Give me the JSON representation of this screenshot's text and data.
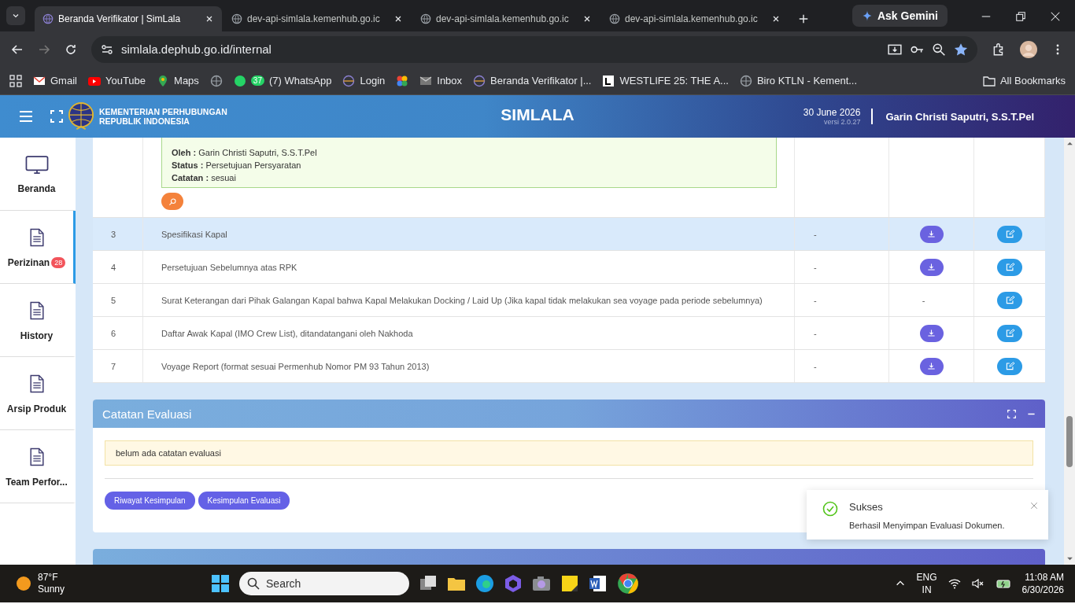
{
  "browser": {
    "tabs": [
      {
        "title": "Beranda Verifikator | SimLala",
        "selected": true
      },
      {
        "title": "dev-api-simlala.kemenhub.go.ic",
        "selected": false
      },
      {
        "title": "dev-api-simlala.kemenhub.go.ic",
        "selected": false
      },
      {
        "title": "dev-api-simlala.kemenhub.go.ic",
        "selected": false
      }
    ],
    "gemini": "Ask Gemini",
    "url": "simlala.dephub.go.id/internal",
    "bookmarks": [
      {
        "kind": "link",
        "label": "Gmail"
      },
      {
        "kind": "link",
        "label": "YouTube"
      },
      {
        "kind": "link",
        "label": "Maps"
      },
      {
        "kind": "icon"
      },
      {
        "kind": "link",
        "label": "(7) WhatsApp"
      },
      {
        "kind": "link",
        "label": "Login"
      },
      {
        "kind": "icon"
      },
      {
        "kind": "link",
        "label": "Inbox"
      },
      {
        "kind": "link",
        "label": "Beranda Verifikator |..."
      },
      {
        "kind": "link",
        "label": "WESTLIFE 25: THE A..."
      },
      {
        "kind": "link",
        "label": "Biro KTLN - Kement..."
      }
    ],
    "whatsapp_badge": "37",
    "all_bookmarks": "All Bookmarks"
  },
  "header": {
    "org_line_1": "KEMENTERIAN PERHUBUNGAN",
    "org_line_2": "REPUBLIK INDONESIA",
    "app_title": "SIMLALA",
    "date": "30 June 2026",
    "version": "versi 2.0.27",
    "user": "Garin Christi Saputri, S.S.T.Pel"
  },
  "sidebar": {
    "items": [
      {
        "label": "Beranda",
        "selected": false
      },
      {
        "label": "Perizinan",
        "selected": true,
        "badge": "28"
      },
      {
        "label": "History",
        "selected": false
      },
      {
        "label": "Arsip Produk",
        "selected": false
      },
      {
        "label": "Team Perfor...",
        "selected": false
      }
    ]
  },
  "history_box": {
    "lines": [
      {
        "label": "Oleh :",
        "value": "Garin Christi Saputri, S.S.T.Pel"
      },
      {
        "label": "Status :",
        "value": "Persetujuan Persyaratan"
      },
      {
        "label": "Catatan :",
        "value": "sesuai"
      }
    ]
  },
  "table": {
    "rows": [
      {
        "number": "3",
        "name": "Spesifikasi Kapal",
        "column_3": "-",
        "file": {
          "kind": "download"
        },
        "selected": true
      },
      {
        "number": "4",
        "name": "Persetujuan Sebelumnya atas RPK",
        "column_3": "-",
        "file": {
          "kind": "download"
        },
        "selected": false
      },
      {
        "number": "5",
        "name": "Surat Keterangan dari Pihak Galangan Kapal bahwa Kapal Melakukan Docking / Laid Up (Jika kapal tidak melakukan sea voyage pada periode sebelumnya)",
        "column_3": "-",
        "file": {
          "kind": "text",
          "text": "-"
        },
        "selected": false
      },
      {
        "number": "6",
        "name": "Daftar Awak Kapal (IMO Crew List), ditandatangani oleh Nakhoda",
        "column_3": "-",
        "file": {
          "kind": "download"
        },
        "selected": false
      },
      {
        "number": "7",
        "name": "Voyage Report (format sesuai Permenhub Nomor PM 93 Tahun 2013)",
        "column_3": "-",
        "file": {
          "kind": "download"
        },
        "selected": false
      }
    ]
  },
  "evaluation": {
    "title": "Catatan Evaluasi",
    "note": "belum ada catatan evaluasi",
    "buttons": [
      "Riwayat Kesimpulan",
      "Kesimpulan Evaluasi"
    ]
  },
  "toast": {
    "title": "Sukses",
    "message": "Berhasil Menyimpan Evaluasi Dokumen."
  },
  "taskbar": {
    "temperature": "87°F",
    "weather": "Sunny",
    "search_placeholder": "Search",
    "language_1": "ENG",
    "language_2": "IN",
    "time": "11:08 AM",
    "date": "6/30/2026"
  }
}
